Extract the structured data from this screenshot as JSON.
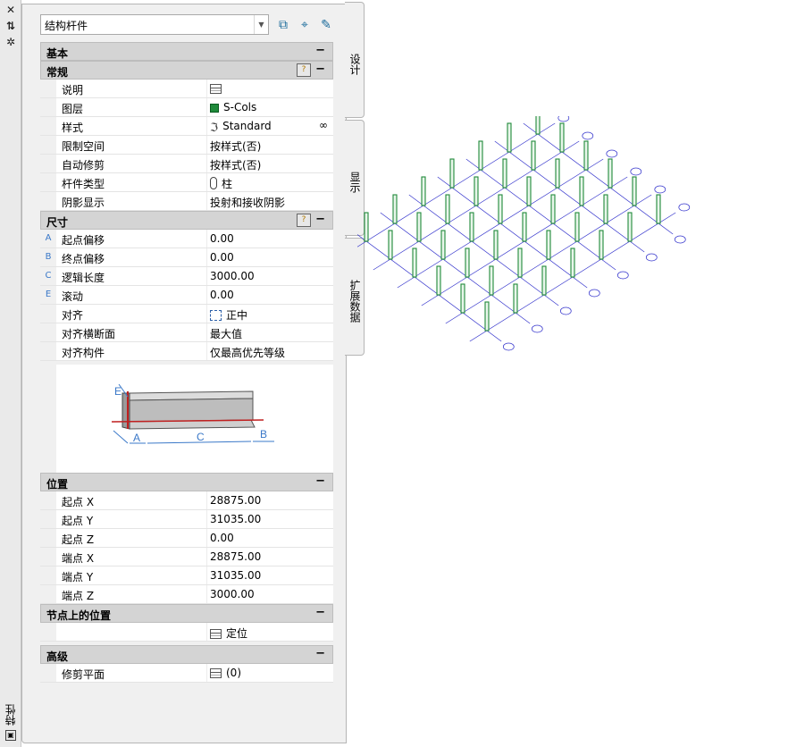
{
  "window": {
    "title": "特性"
  },
  "toolbar": {
    "combo_value": "结构杆件"
  },
  "sections": {
    "basic": "基本",
    "general": "常规",
    "dimensions": "尺寸",
    "location": "位置",
    "node_location": "节点上的位置",
    "advanced": "高级"
  },
  "general": [
    {
      "label": "说明",
      "value": "",
      "icon": "table-icon"
    },
    {
      "label": "图层",
      "value": "S-Cols",
      "icon": "layer-color-icon",
      "color": "#1f8a3a"
    },
    {
      "label": "样式",
      "value": "Standard",
      "icon": "style-icon"
    },
    {
      "label": "限制空间",
      "value": "按样式(否)"
    },
    {
      "label": "自动修剪",
      "value": "按样式(否)"
    },
    {
      "label": "杆件类型",
      "value": "柱",
      "icon": "column-icon"
    },
    {
      "label": "阴影显示",
      "value": "投射和接收阴影"
    }
  ],
  "dimensions": [
    {
      "key": "A",
      "label": "起点偏移",
      "value": "0.00"
    },
    {
      "key": "B",
      "label": "终点偏移",
      "value": "0.00"
    },
    {
      "key": "C",
      "label": "逻辑长度",
      "value": "3000.00"
    },
    {
      "key": "E",
      "label": "滚动",
      "value": "0.00"
    },
    {
      "key": "",
      "label": "对齐",
      "value": "正中",
      "icon": "justify-icon"
    },
    {
      "key": "",
      "label": "对齐横断面",
      "value": "最大值"
    },
    {
      "key": "",
      "label": "对齐构件",
      "value": "仅最高优先等级"
    }
  ],
  "diagram_labels": {
    "a": "A",
    "b": "B",
    "c": "C",
    "e": "E"
  },
  "location": [
    {
      "label": "起点 X",
      "value": "28875.00"
    },
    {
      "label": "起点 Y",
      "value": "31035.00"
    },
    {
      "label": "起点 Z",
      "value": "0.00"
    },
    {
      "label": "端点 X",
      "value": "28875.00"
    },
    {
      "label": "端点 Y",
      "value": "31035.00"
    },
    {
      "label": "端点 Z",
      "value": "3000.00"
    }
  ],
  "node_location": {
    "value": "定位"
  },
  "advanced": {
    "label": "修剪平面",
    "value": "(0)"
  },
  "tabs": [
    "设计",
    "显示",
    "扩展数据"
  ],
  "colors": {
    "column": "#1f8a3a",
    "grid": "#3333cc",
    "accent": "#3a78c8"
  }
}
